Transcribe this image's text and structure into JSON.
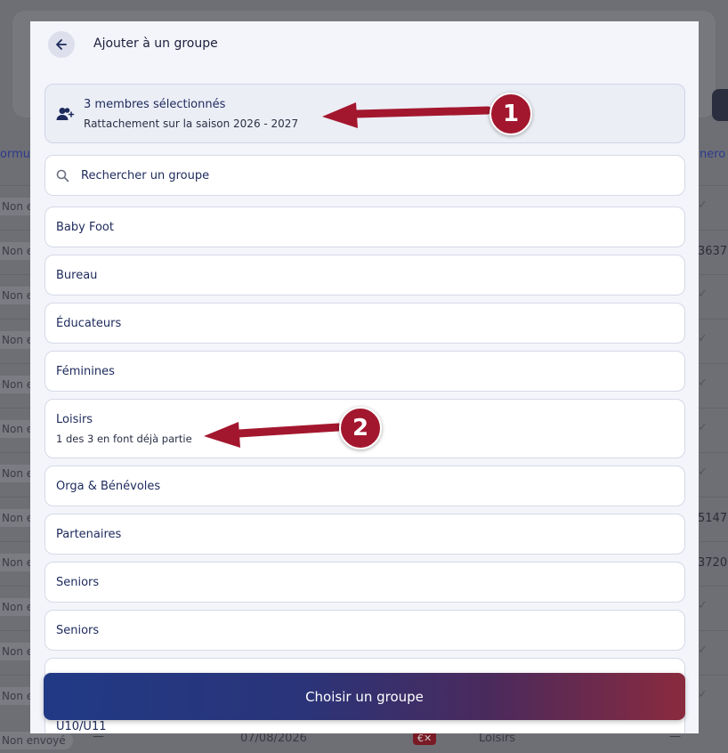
{
  "modal": {
    "title": "Ajouter à un groupe",
    "selection": {
      "line1": "3 membres sélectionnés",
      "line2": "Rattachement sur la saison 2026 - 2027"
    },
    "search_placeholder": "Rechercher un groupe",
    "groups": [
      {
        "label": "Baby Foot",
        "sub": ""
      },
      {
        "label": "Bureau",
        "sub": ""
      },
      {
        "label": "Éducateurs",
        "sub": ""
      },
      {
        "label": "Féminines",
        "sub": ""
      },
      {
        "label": "Loisirs",
        "sub": "1 des 3 en font déjà partie"
      },
      {
        "label": "Orga & Bénévoles",
        "sub": ""
      },
      {
        "label": "Partenaires",
        "sub": ""
      },
      {
        "label": "Seniors",
        "sub": ""
      },
      {
        "label": "Seniors",
        "sub": ""
      },
      {
        "label": "",
        "sub": ""
      },
      {
        "label": "U10/U11",
        "sub": ""
      }
    ],
    "cta_label": "Choisir un groupe"
  },
  "annotations": [
    {
      "label": "1"
    },
    {
      "label": "2"
    }
  ],
  "background": {
    "header_left": "ormu",
    "header_right": "nero",
    "status_label": "Non e",
    "row_numbers": [
      "3637",
      "5147",
      "3720"
    ],
    "last_row": {
      "status": "Non envoyé",
      "dash": "—",
      "date": "07/08/2026",
      "badge": "€✕",
      "group": "Loisirs",
      "dash_right": "—"
    }
  },
  "colors": {
    "accent_navy": "#1d2a5c",
    "annotation_red": "#a3172e",
    "cta_start": "#213a86",
    "cta_end": "#8a2a3e"
  },
  "icons": [
    "arrow-left-icon",
    "user-add-icon",
    "search-icon"
  ]
}
